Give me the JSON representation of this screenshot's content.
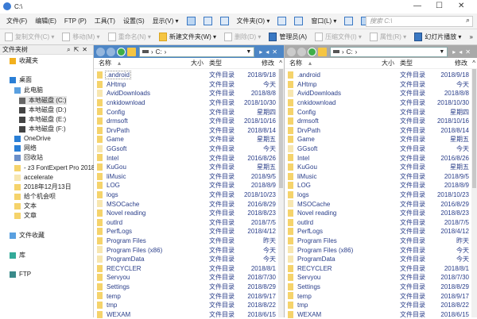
{
  "window": {
    "title": "C:\\",
    "minimize": "—",
    "maximize": "☐",
    "close": "✕"
  },
  "menu": [
    "文件(F)",
    "编辑(E)",
    "FTP (P)",
    "工具(T)",
    "设置(S)",
    "显示(V) ▾",
    "文件夹(O) ▾",
    "窗口(L) ▾"
  ],
  "search": {
    "placeholder": "搜索 C:\\"
  },
  "toolbar": [
    "复制文件(C) ▾",
    "移动(M) ▾",
    "重命名(N) ▾",
    "新建文件夹(W) ▾",
    "删除(D) ▾",
    "管理员(A)",
    "压缩文件(I) ▾",
    "属性(R) ▾",
    "幻灯片播放 ▾",
    "»"
  ],
  "tree": {
    "title": "文件夹树",
    "items": [
      "收藏夹",
      "桌面",
      "此电脑",
      "本地磁盘 (C:)",
      "本地磁盘 (D:)",
      "本地磁盘 (E:)",
      "本地磁盘 (F:)",
      "OneDrive",
      "网络",
      "回收站",
      "- z3 FontExpert Pro 2018",
      "accelerate",
      "2018年12月13日",
      "给个机会呗",
      "文本",
      "文章",
      "文件收藏",
      "库",
      "FTP"
    ]
  },
  "pane": {
    "path": "C:",
    "columns": {
      "name": "名称",
      "size": "大小",
      "type": "类型",
      "modified": "修改"
    }
  },
  "files": [
    [
      ".android",
      "文件目录",
      "2018/9/18"
    ],
    [
      "AHtmp",
      "文件目录",
      "今天"
    ],
    [
      "AvidDownloads",
      "文件目录",
      "2018/8/8"
    ],
    [
      "cnkidownload",
      "文件目录",
      "2018/10/30"
    ],
    [
      "Config",
      "文件目录",
      "星期四"
    ],
    [
      "drmsoft",
      "文件目录",
      "2018/10/16"
    ],
    [
      "DrvPath",
      "文件目录",
      "2018/8/14"
    ],
    [
      "Game",
      "文件目录",
      "星期五"
    ],
    [
      "GGsoft",
      "文件目录",
      "今天"
    ],
    [
      "Intel",
      "文件目录",
      "2016/8/26"
    ],
    [
      "KuGou",
      "文件目录",
      "星期五"
    ],
    [
      "liMusic",
      "文件目录",
      "2018/9/5"
    ],
    [
      "LOG",
      "文件目录",
      "2018/8/9"
    ],
    [
      "logs",
      "文件目录",
      "2018/10/23"
    ],
    [
      "MSOCache",
      "文件目录",
      "2016/8/29"
    ],
    [
      "Novel reading",
      "文件目录",
      "2018/8/23"
    ],
    [
      "outlrd",
      "文件目录",
      "2018/7/5"
    ],
    [
      "PerfLogs",
      "文件目录",
      "2018/4/12"
    ],
    [
      "Program Files",
      "文件目录",
      "昨天"
    ],
    [
      "Program Files (x86)",
      "文件目录",
      "今天"
    ],
    [
      "ProgramData",
      "文件目录",
      "今天"
    ],
    [
      "RECYCLER",
      "文件目录",
      "2018/8/1"
    ],
    [
      "Servyou",
      "文件目录",
      "2018/7/30"
    ],
    [
      "Settings",
      "文件目录",
      "2018/8/29"
    ],
    [
      "temp",
      "文件目录",
      "2018/9/17"
    ],
    [
      "tmp",
      "文件目录",
      "2018/8/22"
    ],
    [
      "WEXAM",
      "文件目录",
      "2018/6/15"
    ]
  ]
}
